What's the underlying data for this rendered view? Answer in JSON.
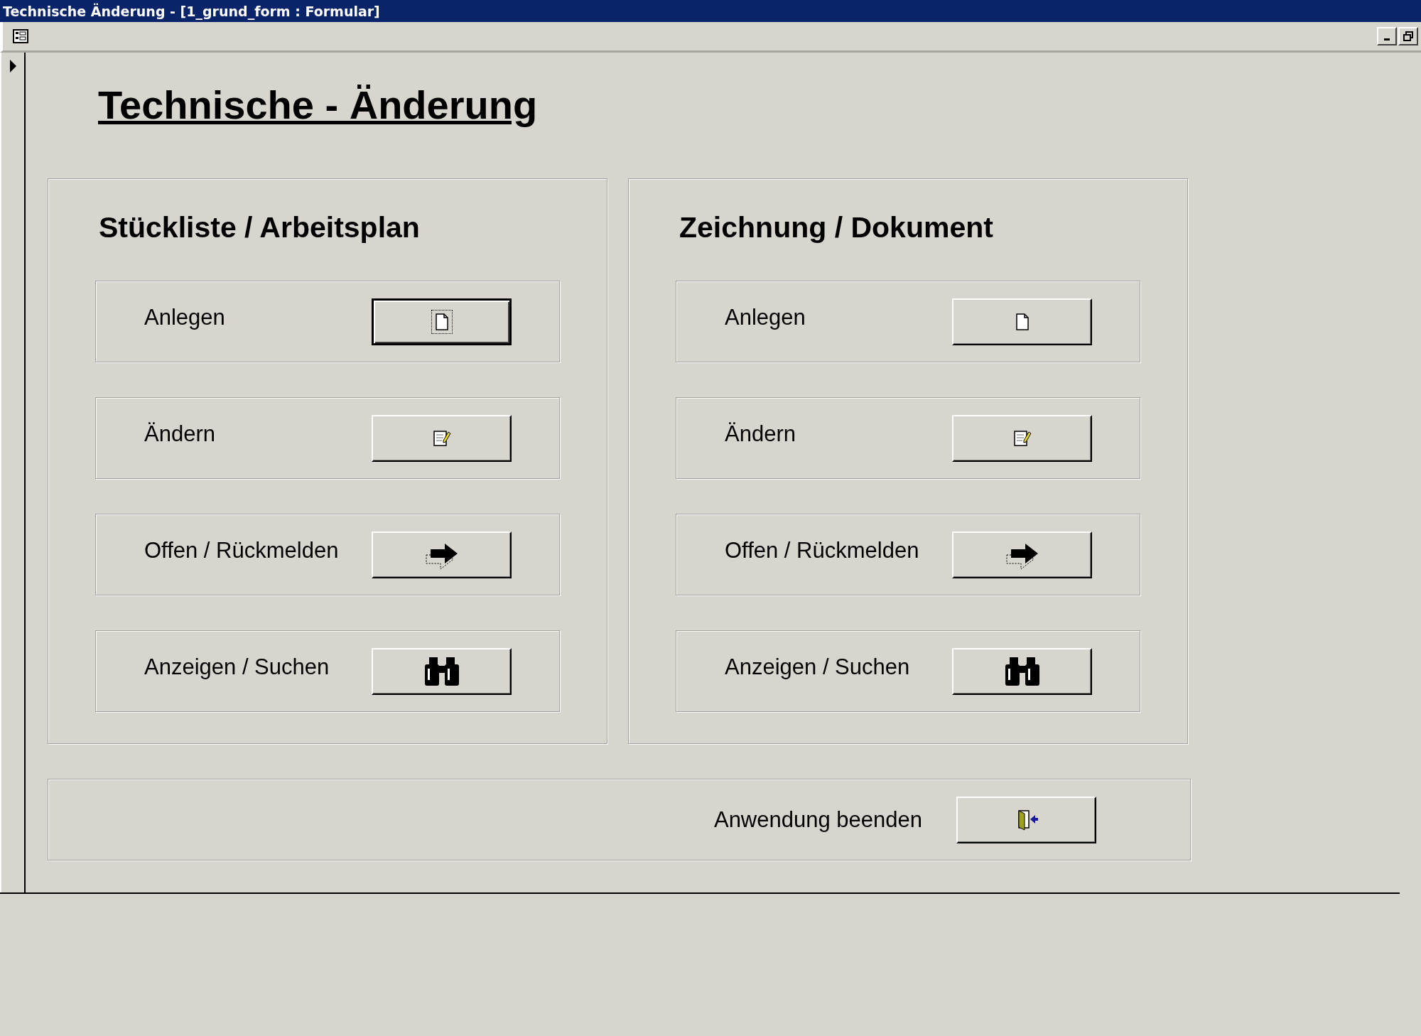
{
  "window": {
    "title": "Technische Änderung - [1_grund_form : Formular]"
  },
  "heading": "Technische - Änderung",
  "groups": [
    {
      "title": "Stückliste / Arbeitsplan",
      "actions": [
        {
          "label": "Anlegen",
          "kind": "new",
          "focused": true
        },
        {
          "label": "Ändern",
          "kind": "edit",
          "focused": false
        },
        {
          "label": "Offen / Rückmelden",
          "kind": "forward",
          "focused": false
        },
        {
          "label": "Anzeigen / Suchen",
          "kind": "search",
          "focused": false
        }
      ]
    },
    {
      "title": "Zeichnung / Dokument",
      "actions": [
        {
          "label": "Anlegen",
          "kind": "new",
          "focused": false
        },
        {
          "label": "Ändern",
          "kind": "edit",
          "focused": false
        },
        {
          "label": "Offen / Rückmelden",
          "kind": "forward",
          "focused": false
        },
        {
          "label": "Anzeigen / Suchen",
          "kind": "search",
          "focused": false
        }
      ]
    }
  ],
  "exit": {
    "label": "Anwendung beenden",
    "kind": "exit",
    "focused": false
  }
}
